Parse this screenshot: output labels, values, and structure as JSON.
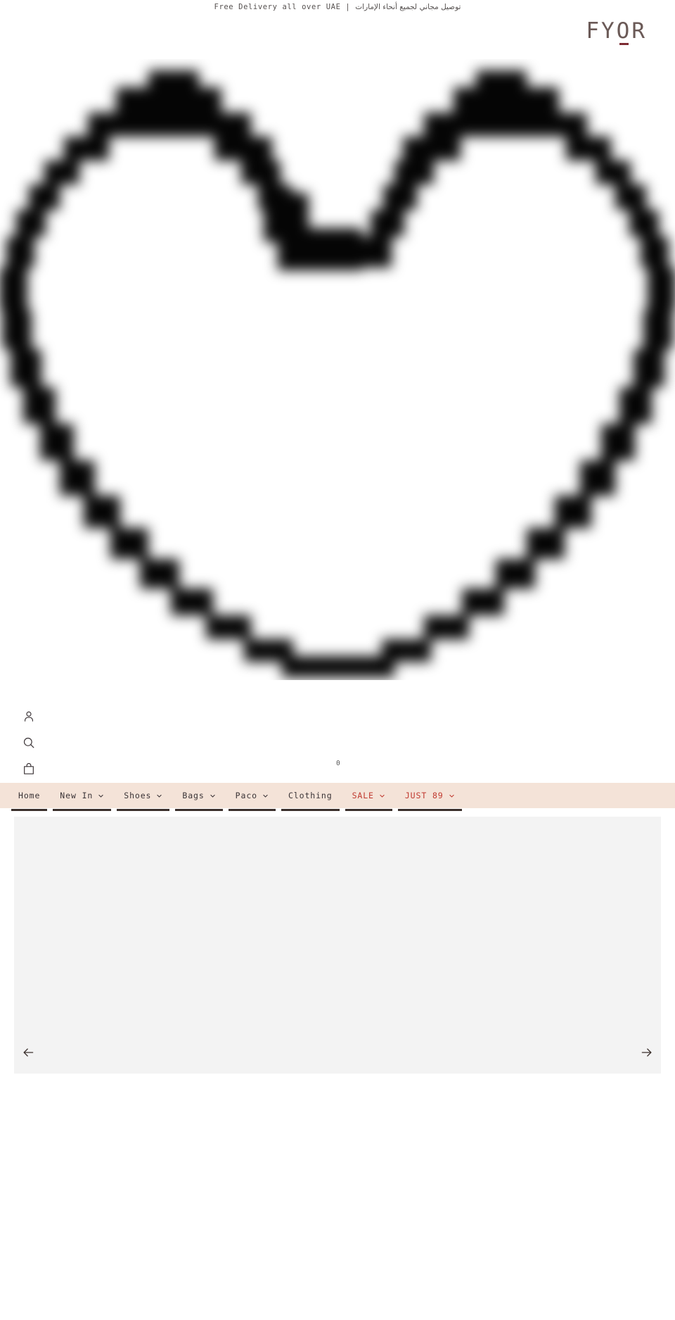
{
  "announcement": {
    "text_en": "Free Delivery all over UAE  |  ",
    "text_ar": "توصيل مجاني لجميع أنحاء الإمارات"
  },
  "header": {
    "logo": "FYOR",
    "logo_color": "#6b5a57",
    "logo_accent_color": "#7d2c33"
  },
  "hero": {
    "alt": "pixelated heart outline",
    "shape": "heart",
    "color": "#0a0a0a"
  },
  "utility_icons": [
    {
      "name": "account-icon",
      "label": "Account"
    },
    {
      "name": "search-icon",
      "label": "Search"
    },
    {
      "name": "cart-icon",
      "label": "Cart"
    }
  ],
  "cart": {
    "count": "0"
  },
  "nav": {
    "background": "#f4e3d8",
    "sale_color": "#c0392f",
    "items": [
      {
        "label": "Home",
        "has_dropdown": false,
        "sale": false
      },
      {
        "label": "New In",
        "has_dropdown": true,
        "sale": false
      },
      {
        "label": "Shoes",
        "has_dropdown": true,
        "sale": false
      },
      {
        "label": "Bags",
        "has_dropdown": true,
        "sale": false
      },
      {
        "label": "Paco",
        "has_dropdown": true,
        "sale": false
      },
      {
        "label": "Clothing",
        "has_dropdown": false,
        "sale": false
      },
      {
        "label": "SALE",
        "has_dropdown": true,
        "sale": true
      },
      {
        "label": "JUST 89",
        "has_dropdown": true,
        "sale": true
      }
    ]
  },
  "carousel": {
    "background": "#f3f3f3",
    "prev_label": "Previous slide",
    "next_label": "Next slide"
  }
}
